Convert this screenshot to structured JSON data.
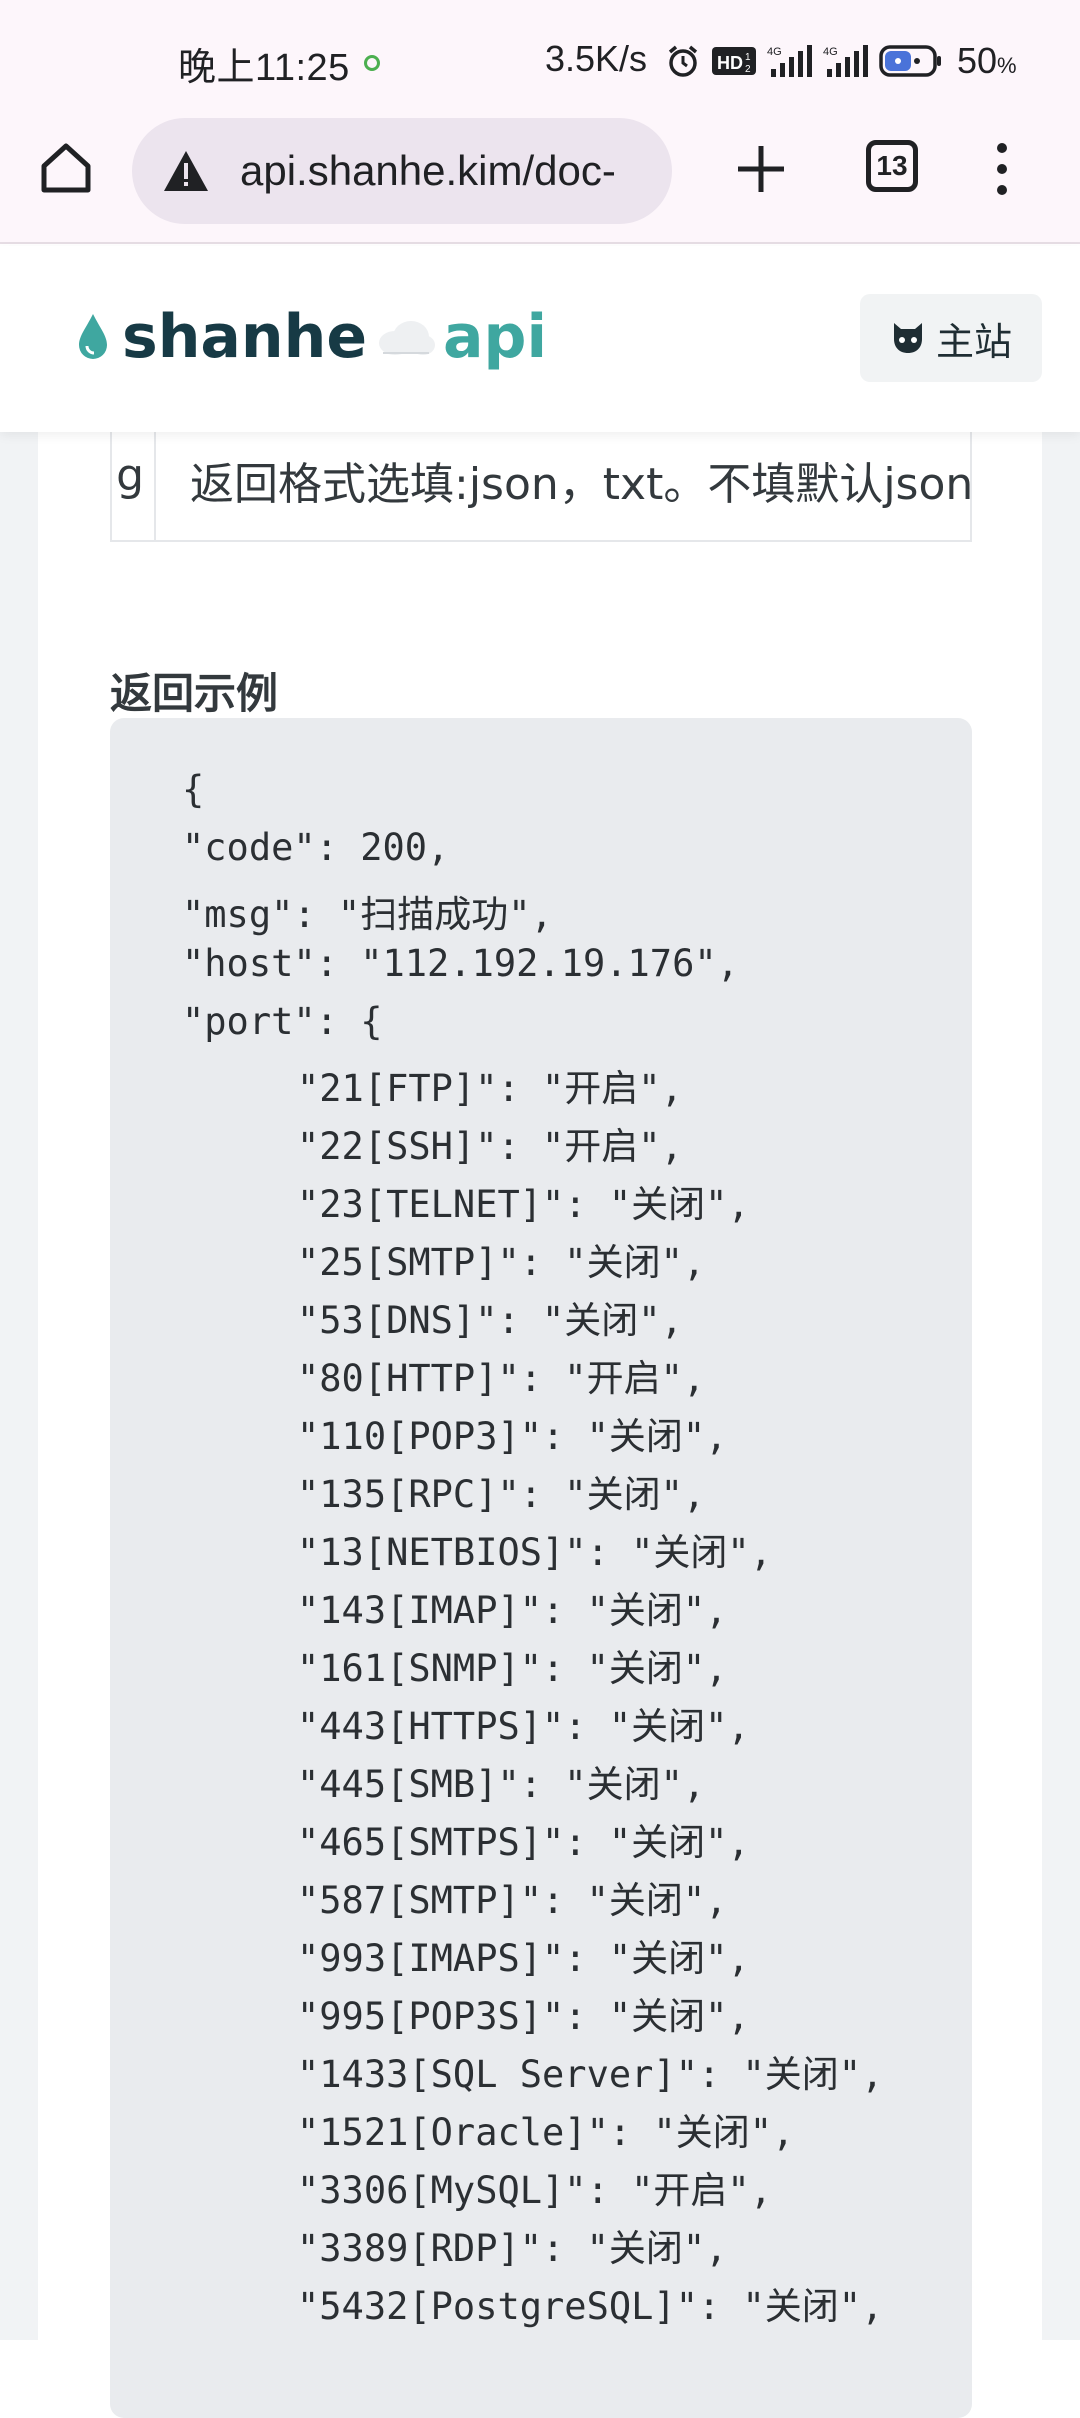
{
  "status_bar": {
    "time": "晚上11:25",
    "speed": "3.5K/s",
    "battery": "50",
    "battery_unit": "%",
    "icons": [
      "alarm-icon",
      "hd-icon",
      "signal-4g-icon",
      "signal-4g-icon",
      "battery-icon"
    ]
  },
  "browser": {
    "url": "api.shanhe.kim/doc-",
    "tab_count": "13",
    "url_icon": "warning-icon"
  },
  "site": {
    "brand_name": "shanhe",
    "brand_suffix": "api",
    "home_button_label": "主站",
    "colors": {
      "brand_dark": "#173a45",
      "brand_accent": "#3fa7a0"
    }
  },
  "params": {
    "cut_name_fragment": "g",
    "format_description": "返回格式选填:json，txt。不填默认json"
  },
  "example": {
    "title": "返回示例",
    "lines": [
      {
        "indent": 0,
        "text": "{"
      },
      {
        "indent": 0,
        "text": "\"code\": 200,"
      },
      {
        "indent": 0,
        "text": "\"msg\": \"扫描成功\","
      },
      {
        "indent": 0,
        "text": "\"host\": \"112.192.19.176\","
      },
      {
        "indent": 0,
        "text": "\"port\": {"
      },
      {
        "indent": 1,
        "text": "\"21[FTP]\": \"开启\","
      },
      {
        "indent": 1,
        "text": "\"22[SSH]\": \"开启\","
      },
      {
        "indent": 1,
        "text": "\"23[TELNET]\": \"关闭\","
      },
      {
        "indent": 1,
        "text": "\"25[SMTP]\": \"关闭\","
      },
      {
        "indent": 1,
        "text": "\"53[DNS]\": \"关闭\","
      },
      {
        "indent": 1,
        "text": "\"80[HTTP]\": \"开启\","
      },
      {
        "indent": 1,
        "text": "\"110[POP3]\": \"关闭\","
      },
      {
        "indent": 1,
        "text": "\"135[RPC]\": \"关闭\","
      },
      {
        "indent": 1,
        "text": "\"13[NETBIOS]\": \"关闭\","
      },
      {
        "indent": 1,
        "text": "\"143[IMAP]\": \"关闭\","
      },
      {
        "indent": 1,
        "text": "\"161[SNMP]\": \"关闭\","
      },
      {
        "indent": 1,
        "text": "\"443[HTTPS]\": \"关闭\","
      },
      {
        "indent": 1,
        "text": "\"445[SMB]\": \"关闭\","
      },
      {
        "indent": 1,
        "text": "\"465[SMTPS]\": \"关闭\","
      },
      {
        "indent": 1,
        "text": "\"587[SMTP]\": \"关闭\","
      },
      {
        "indent": 1,
        "text": "\"993[IMAPS]\": \"关闭\","
      },
      {
        "indent": 1,
        "text": "\"995[POP3S]\": \"关闭\","
      },
      {
        "indent": 1,
        "text": "\"1433[SQL Server]\": \"关闭\","
      },
      {
        "indent": 1,
        "text": "\"1521[Oracle]\": \"关闭\","
      },
      {
        "indent": 1,
        "text": "\"3306[MySQL]\": \"开启\","
      },
      {
        "indent": 1,
        "text": "\"3389[RDP]\": \"关闭\","
      },
      {
        "indent": 1,
        "text": "\"5432[PostgreSQL]\": \"关闭\","
      }
    ]
  }
}
